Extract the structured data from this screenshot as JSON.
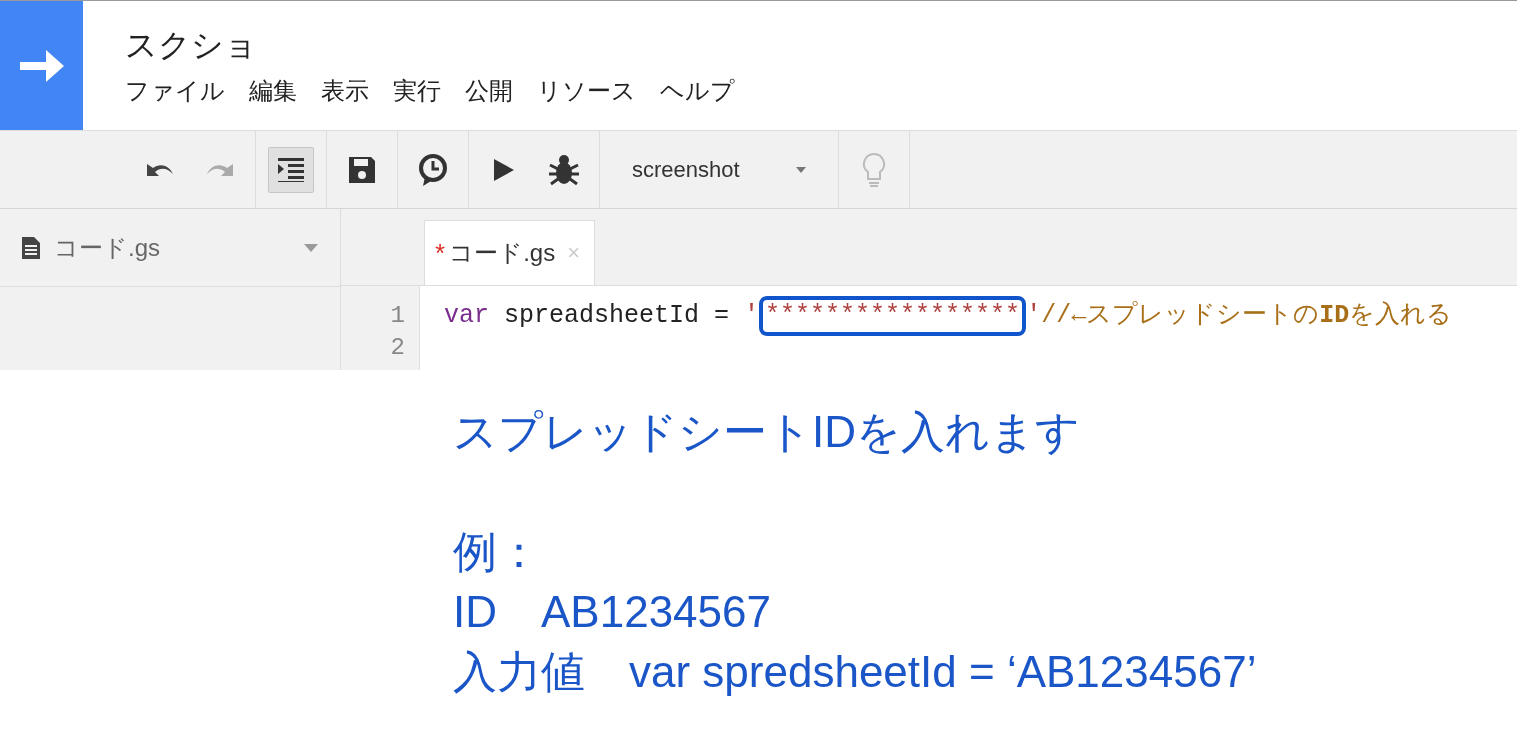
{
  "app": {
    "title": "スクショ",
    "menu": [
      "ファイル",
      "編集",
      "表示",
      "実行",
      "公開",
      "リソース",
      "ヘルプ"
    ]
  },
  "toolbar": {
    "indent_selected": true,
    "function": "screenshot"
  },
  "sidebar": {
    "files": [
      {
        "name": "コード.gs"
      }
    ]
  },
  "editor": {
    "tabs": [
      {
        "label": "コード.gs",
        "modified_mark": "*",
        "close": "×",
        "selected": true
      }
    ],
    "lines": [
      {
        "number": "1",
        "tokens": [
          {
            "kind": "keyword",
            "text": "var",
            "highlighted": false
          },
          {
            "kind": "plain",
            "text": " spreadsheetId = ",
            "highlighted": false
          },
          {
            "kind": "string",
            "text": "'",
            "highlighted": false
          },
          {
            "kind": "string",
            "text": "*****************",
            "highlighted": true
          },
          {
            "kind": "string",
            "text": "'",
            "highlighted": false
          },
          {
            "kind": "comment",
            "text": "//←スプレッドシートの**ID**を入れる",
            "highlighted": false
          }
        ]
      },
      {
        "number": "2"
      }
    ]
  },
  "annotation": {
    "heading": "スプレッドシートIDを入れます",
    "lines": [
      "例：",
      "ID　AB1234567",
      "入力値　var spredsheetId = ‘AB1234567’"
    ]
  }
}
